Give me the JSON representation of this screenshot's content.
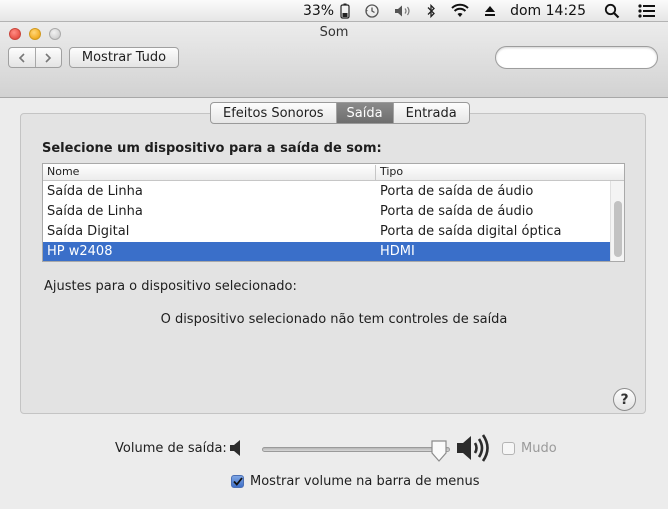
{
  "menubar": {
    "battery": "33%",
    "clock": "dom 14:25",
    "icons": [
      "battery-icon",
      "time-machine-icon",
      "volume-icon",
      "bluetooth-icon",
      "wifi-icon",
      "eject-icon",
      "spotlight-icon",
      "notification-center-icon"
    ]
  },
  "window": {
    "title": "Som",
    "show_all": "Mostrar Tudo",
    "search_placeholder": ""
  },
  "tabs": [
    {
      "label": "Efeitos Sonoros",
      "active": false
    },
    {
      "label": "Saída",
      "active": true
    },
    {
      "label": "Entrada",
      "active": false
    }
  ],
  "output": {
    "select_label": "Selecione um dispositivo para a saída de som:",
    "columns": [
      "Nome",
      "Tipo"
    ],
    "rows": [
      {
        "name": "Saída de Linha",
        "type": "Porta de saída de áudio",
        "selected": false
      },
      {
        "name": "Saída de Linha",
        "type": "Porta de saída de áudio",
        "selected": false
      },
      {
        "name": "Saída Digital",
        "type": "Porta de saída digital óptica",
        "selected": false
      },
      {
        "name": "HP w2408",
        "type": "HDMI",
        "selected": true
      }
    ],
    "adjust_label": "Ajustes para o dispositivo selecionado:",
    "no_controls": "O dispositivo selecionado não tem controles de saída"
  },
  "volume": {
    "label": "Volume de saída:",
    "level": 0.94,
    "mute_label": "Mudo",
    "mute_checked": false,
    "mute_enabled": false,
    "show_in_menubar_label": "Mostrar volume na barra de menus",
    "show_in_menubar_checked": true
  },
  "help": "?",
  "colors": {
    "selection": "#3a6fc9",
    "active_tab": "#7a7a7a"
  }
}
